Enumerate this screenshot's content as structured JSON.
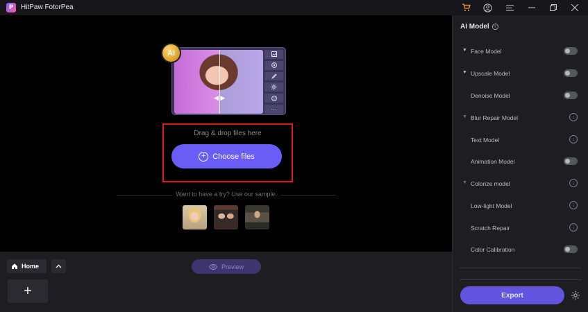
{
  "window": {
    "logo_letter": "P",
    "title": "HitPaw FotorPea",
    "icons": [
      "cart-icon",
      "user-icon",
      "menu-icon",
      "minimize-icon",
      "restore-icon",
      "close-icon"
    ]
  },
  "main": {
    "ai_badge": "AI",
    "preview_tools": [
      "image-icon",
      "target-icon",
      "brush-icon",
      "sun-icon",
      "palette-icon",
      "more-icon"
    ],
    "more_label": "···",
    "drop_text": "Drag & drop files here",
    "choose_label": "Choose files",
    "sample_text": "Want to have a try? Use our sample.",
    "sample_count": 3
  },
  "bottom": {
    "home_label": "Home",
    "preview_label": "Preview",
    "add_label": "+"
  },
  "panel": {
    "title": "AI Model",
    "models": [
      {
        "label": "Face Model",
        "chevron": true,
        "control": "toggle"
      },
      {
        "label": "Upscale Model",
        "chevron": true,
        "control": "toggle"
      },
      {
        "label": "Denoise Model",
        "chevron": false,
        "control": "toggle"
      },
      {
        "label": "Blur Repair Model",
        "chevron": true,
        "control": "download"
      },
      {
        "label": "Text Model",
        "chevron": false,
        "control": "download"
      },
      {
        "label": "Animation Model",
        "chevron": false,
        "control": "toggle"
      },
      {
        "label": "Colorize model",
        "chevron": true,
        "control": "download"
      },
      {
        "label": "Low-light Model",
        "chevron": false,
        "control": "download"
      },
      {
        "label": "Scratch Repair",
        "chevron": false,
        "control": "download"
      },
      {
        "label": "Color Calibration",
        "chevron": false,
        "control": "toggle"
      }
    ],
    "export_label": "Export"
  },
  "colors": {
    "accent": "#6a5cf6",
    "export": "#6254de",
    "drop_border": "#e01919",
    "panel_bg": "#1d1d22"
  }
}
